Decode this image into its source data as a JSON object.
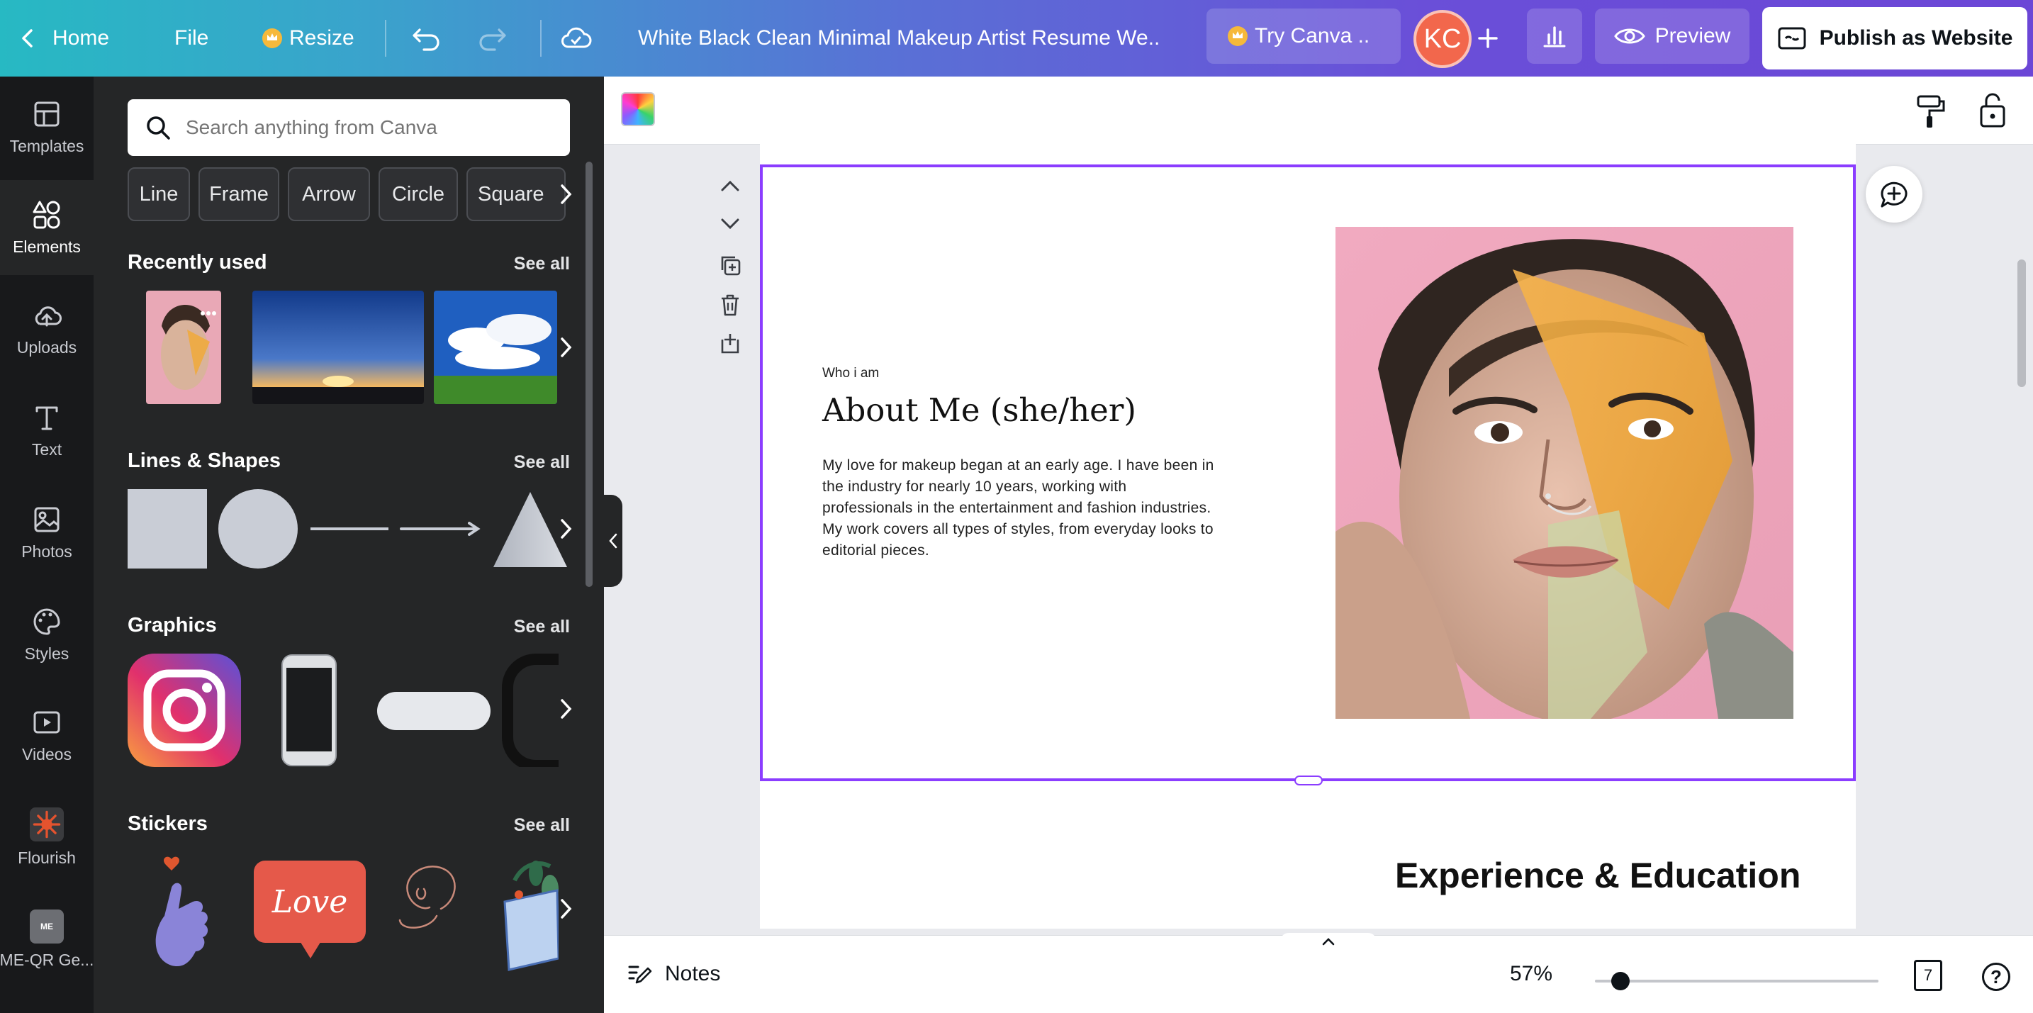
{
  "topbar": {
    "home": "Home",
    "file": "File",
    "resize": "Resize",
    "doc_title": "White Black Clean Minimal Makeup Artist Resume We..",
    "try_canva": "Try Canva ..",
    "avatar_initials": "KC",
    "preview": "Preview",
    "publish": "Publish as Website"
  },
  "rail": {
    "items": [
      {
        "label": "Templates",
        "icon": "templates-icon"
      },
      {
        "label": "Elements",
        "icon": "elements-icon"
      },
      {
        "label": "Uploads",
        "icon": "uploads-icon"
      },
      {
        "label": "Text",
        "icon": "text-icon"
      },
      {
        "label": "Photos",
        "icon": "photos-icon"
      },
      {
        "label": "Styles",
        "icon": "styles-icon"
      },
      {
        "label": "Videos",
        "icon": "videos-icon"
      },
      {
        "label": "Flourish",
        "icon": "flourish-app-icon"
      },
      {
        "label": "ME-QR Ge...",
        "icon": "me-qr-app-icon"
      }
    ]
  },
  "panel": {
    "search_placeholder": "Search anything from Canva",
    "chips": [
      "Line",
      "Frame",
      "Arrow",
      "Circle",
      "Square"
    ],
    "recently_used": "Recently used",
    "lines_shapes": "Lines & Shapes",
    "graphics": "Graphics",
    "stickers": "Stickers",
    "see_all": "See all",
    "sticker_love": "Love"
  },
  "page": {
    "eyebrow": "Who i am",
    "title": "About Me (she/her)",
    "body": "My love for makeup began at an early age. I have been in the industry for nearly 10 years, working with professionals in the entertainment and fashion industries. My work covers all types of styles, from everyday looks to editorial pieces.",
    "next_section_title": "Experience & Education"
  },
  "bottombar": {
    "notes": "Notes",
    "zoom": "57%",
    "zoom_fraction": 0.09,
    "page_count": "7",
    "help": "?"
  },
  "colors": {
    "accent": "#8b3dff",
    "avatar": "#f2674c",
    "rail_bg": "#18191b",
    "panel_bg": "#252627"
  }
}
